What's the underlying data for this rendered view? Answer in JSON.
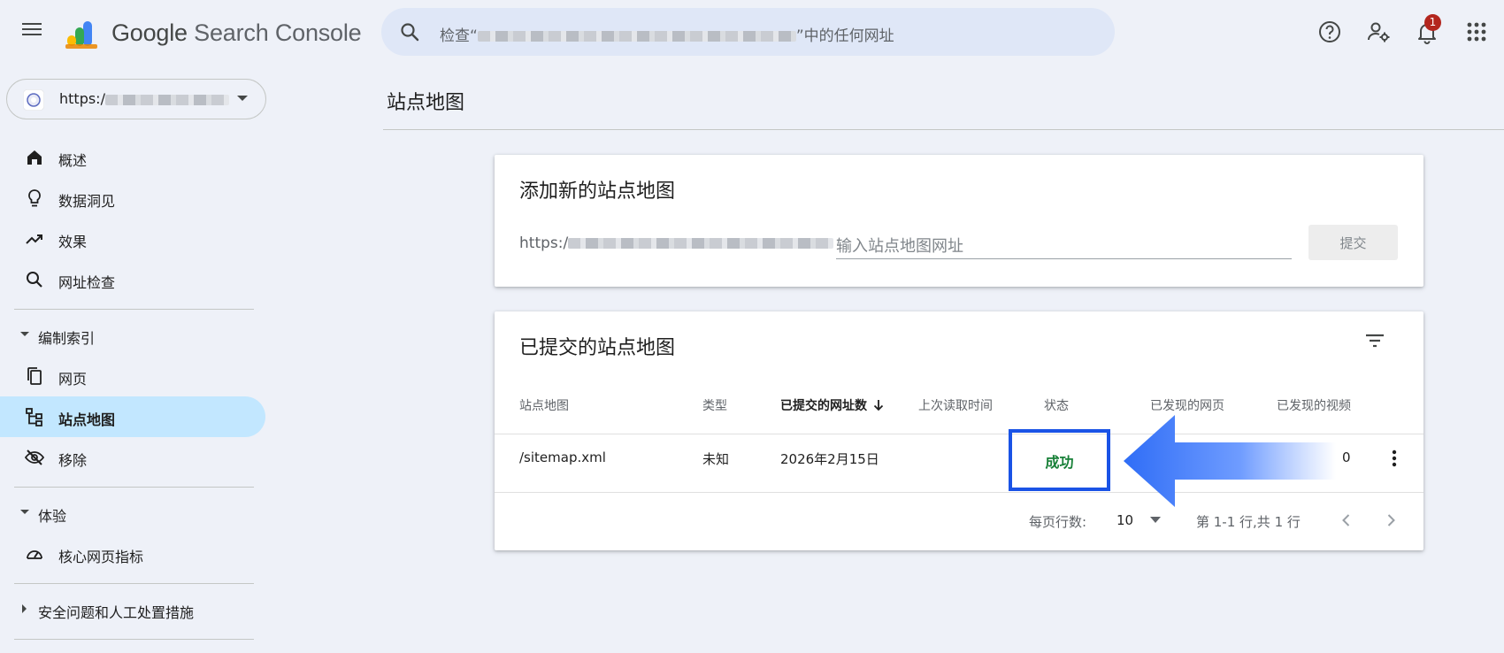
{
  "header": {
    "app_title_prefix": "Google",
    "app_title_suffix": " Search Console",
    "search_prefix": "检查“",
    "search_suffix": "”中的任何网址",
    "notification_count": "1",
    "icons": [
      "menu-icon",
      "search-icon",
      "help-icon",
      "manage-users-icon",
      "bell-icon",
      "apps-icon"
    ]
  },
  "property": {
    "url_prefix": "https:/"
  },
  "sidebar": {
    "items": [
      {
        "label": "概述",
        "icon": "home-icon"
      },
      {
        "label": "数据洞见",
        "icon": "lightbulb-icon"
      },
      {
        "label": "效果",
        "icon": "trending-up-icon"
      },
      {
        "label": "网址检查",
        "icon": "search-icon"
      }
    ],
    "section_index": "编制索引",
    "index_items": [
      {
        "label": "网页",
        "icon": "pages-icon"
      },
      {
        "label": "站点地图",
        "icon": "sitemap-icon",
        "active": true
      },
      {
        "label": "移除",
        "icon": "visibility-off-icon"
      }
    ],
    "section_experience": "体验",
    "experience_items": [
      {
        "label": "核心网页指标",
        "icon": "speed-icon"
      }
    ],
    "section_security": "安全问题和人工处置措施"
  },
  "page": {
    "title": "站点地图"
  },
  "add_card": {
    "title": "添加新的站点地图",
    "url_prefix": "https:/",
    "input_placeholder": "输入站点地图网址",
    "submit_label": "提交"
  },
  "submitted_card": {
    "title": "已提交的站点地图",
    "columns": [
      "站点地图",
      "类型",
      "已提交的网址数",
      "上次读取时间",
      "状态",
      "已发现的网页",
      "已发现的视频"
    ],
    "rows": [
      {
        "sitemap": "/sitemap.xml",
        "type": "未知",
        "submitted": "2026年2月15日",
        "last_read": "",
        "status": "成功",
        "pages": "",
        "videos": "0"
      }
    ],
    "footer": {
      "rows_per_page_label": "每页行数:",
      "rows_per_page_value": "10",
      "range_text": "第 1-1 行,共 1 行"
    }
  },
  "colors": {
    "accent": "#1a53e6",
    "success": "#188038",
    "active_nav": "#c2e7ff",
    "badge": "#b3261e"
  }
}
